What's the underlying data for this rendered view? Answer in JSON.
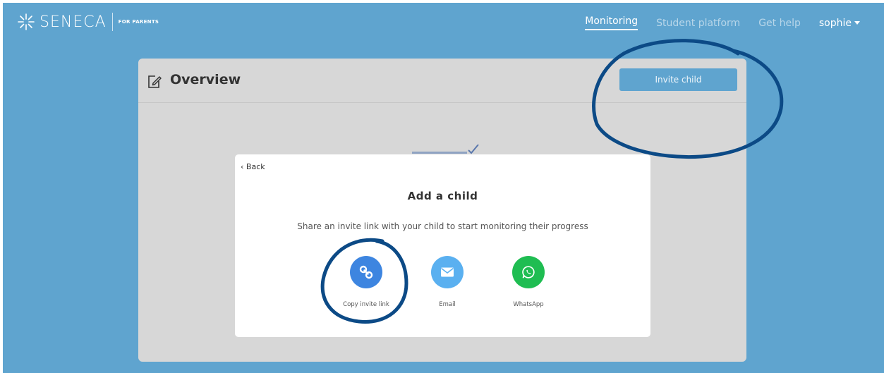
{
  "header": {
    "logo_text": "SENECA",
    "logo_tagline": "FOR PARENTS",
    "nav": [
      {
        "label": "Monitoring",
        "active": true
      },
      {
        "label": "Student platform"
      },
      {
        "label": "Get help"
      }
    ],
    "user_name": "sophie"
  },
  "overview": {
    "title": "Overview",
    "invite_button_label": "Invite child"
  },
  "modal": {
    "back_label": "Back",
    "back_glyph": "‹",
    "title": "Add a child",
    "description": "Share an invite link with your child to start monitoring their progress",
    "share_options": [
      {
        "label": "Copy invite link",
        "icon": "link-icon",
        "color": "#3d85e0"
      },
      {
        "label": "Email",
        "icon": "envelope-icon",
        "color": "#5ab0f0"
      },
      {
        "label": "WhatsApp",
        "icon": "whatsapp-icon",
        "color": "#1fbd52"
      }
    ]
  },
  "colors": {
    "background": "#5fa4cf",
    "annotation": "#0c4a86"
  }
}
